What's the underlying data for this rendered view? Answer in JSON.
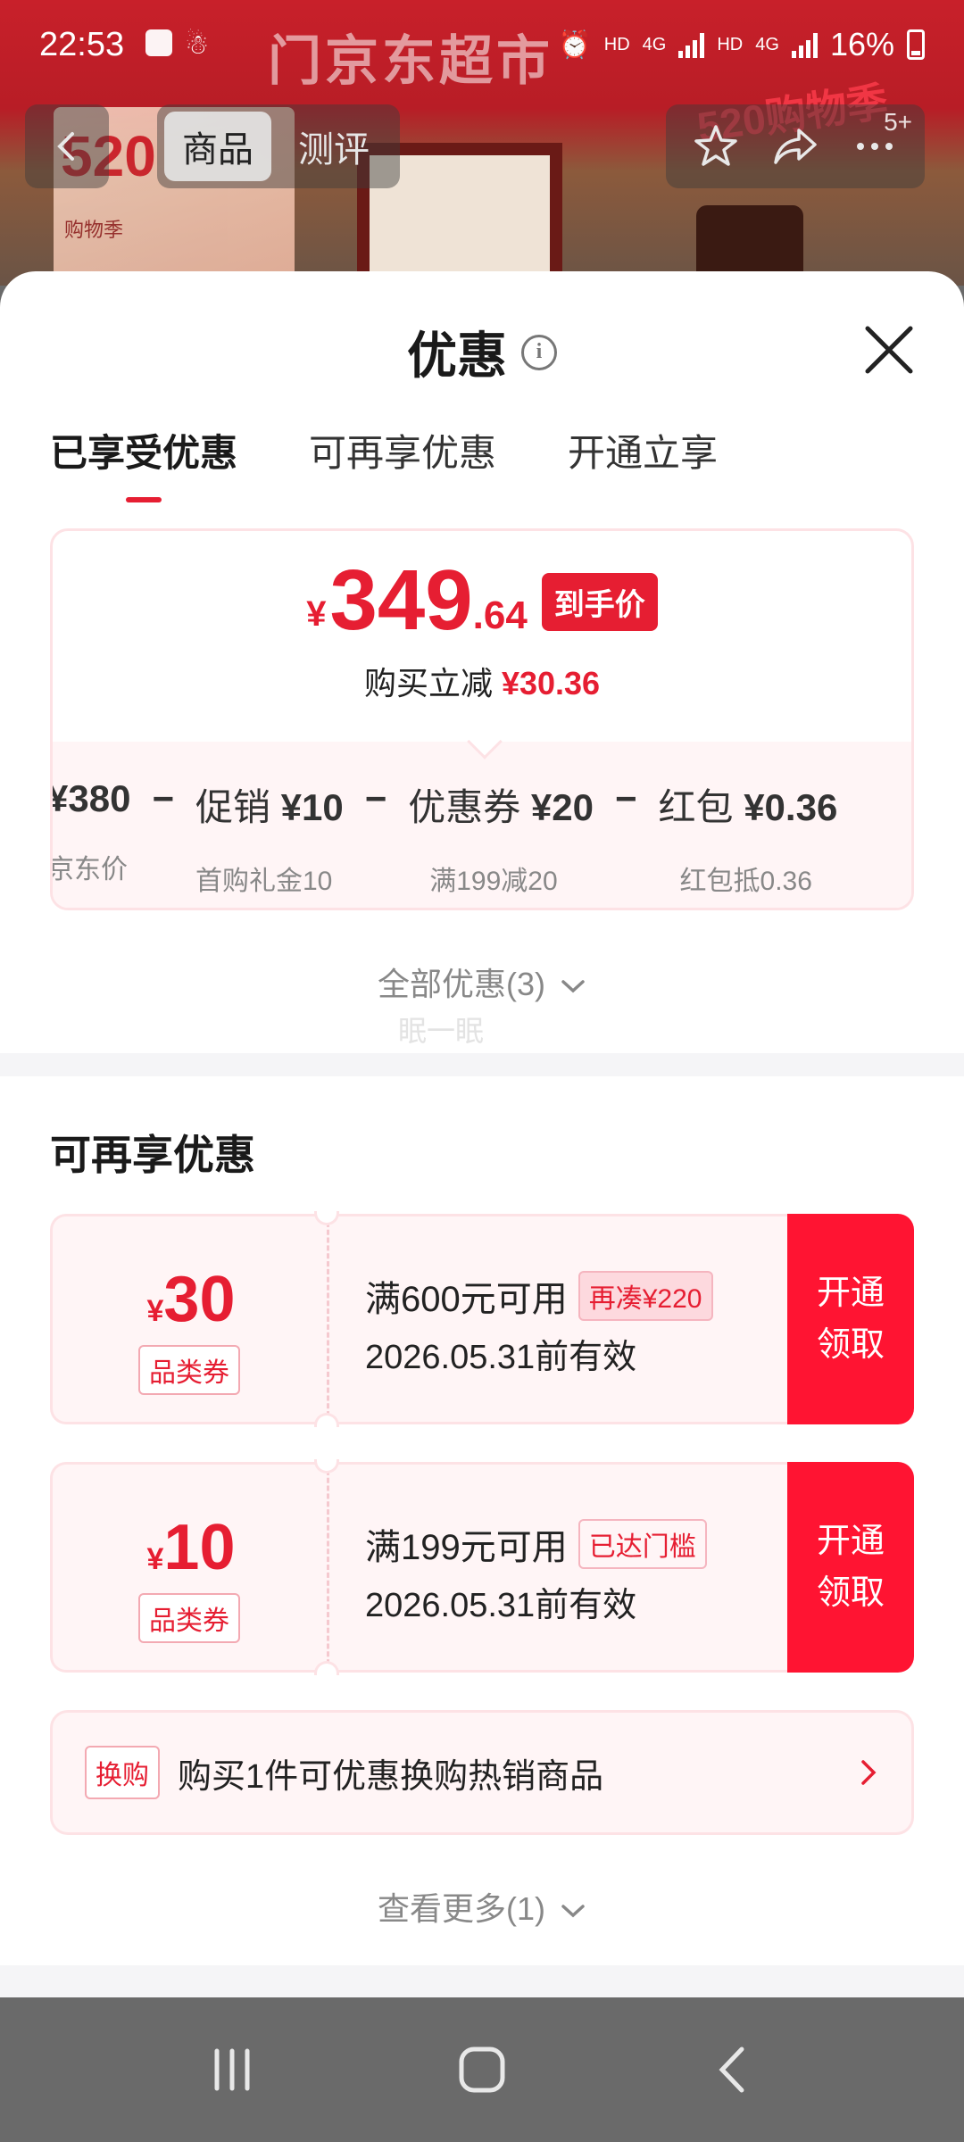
{
  "status_bar": {
    "time": "22:53",
    "network_1": "HD",
    "network_2": "4G",
    "network_3": "HD",
    "network_4": "4G",
    "battery": "16%"
  },
  "background": {
    "brand_text": "门京东超市",
    "poster_big": "520",
    "poster_sub": "购物季",
    "promo_right": "520购物季"
  },
  "nav": {
    "tabs": [
      "商品",
      "测评"
    ],
    "badge": "5+"
  },
  "sheet": {
    "title": "优惠",
    "tabs": [
      "已享受优惠",
      "可再享优惠",
      "开通立享"
    ]
  },
  "price": {
    "currency": "¥",
    "integer": "349",
    "decimal": ".64",
    "tag": "到手价",
    "save_label": "购买立减",
    "save_value": "¥30.36"
  },
  "breakdown": [
    {
      "main_prefix": "",
      "main_value": "¥380",
      "sub": "京东价"
    },
    {
      "main_prefix": "促销 ",
      "main_value": "¥10",
      "sub": "首购礼金10"
    },
    {
      "main_prefix": "优惠券 ",
      "main_value": "¥20",
      "sub": "满199减20"
    },
    {
      "main_prefix": "红包 ",
      "main_value": "¥0.36",
      "sub": "红包抵0.36"
    }
  ],
  "all_offers": "全部优惠(3)",
  "ghost_text": "眠一眠",
  "section_title": "可再享优惠",
  "coupons": [
    {
      "currency": "¥",
      "amount": "30",
      "type": "品类券",
      "condition": "满600元可用",
      "badge": "再凑¥220",
      "expiry": "2026.05.31前有效",
      "action_1": "开通",
      "action_2": "领取"
    },
    {
      "currency": "¥",
      "amount": "10",
      "type": "品类券",
      "condition": "满199元可用",
      "badge": "已达门槛",
      "expiry": "2026.05.31前有效",
      "action_1": "开通",
      "action_2": "领取"
    }
  ],
  "swap": {
    "tag": "换购",
    "text": "购买1件可优惠换购热销商品"
  },
  "see_more": "查看更多(1)",
  "colors": {
    "accent": "#e61e32",
    "coupon_action_bg": "#ff1432",
    "card_tint": "#fff5f6",
    "card_border": "#fde2e5"
  }
}
